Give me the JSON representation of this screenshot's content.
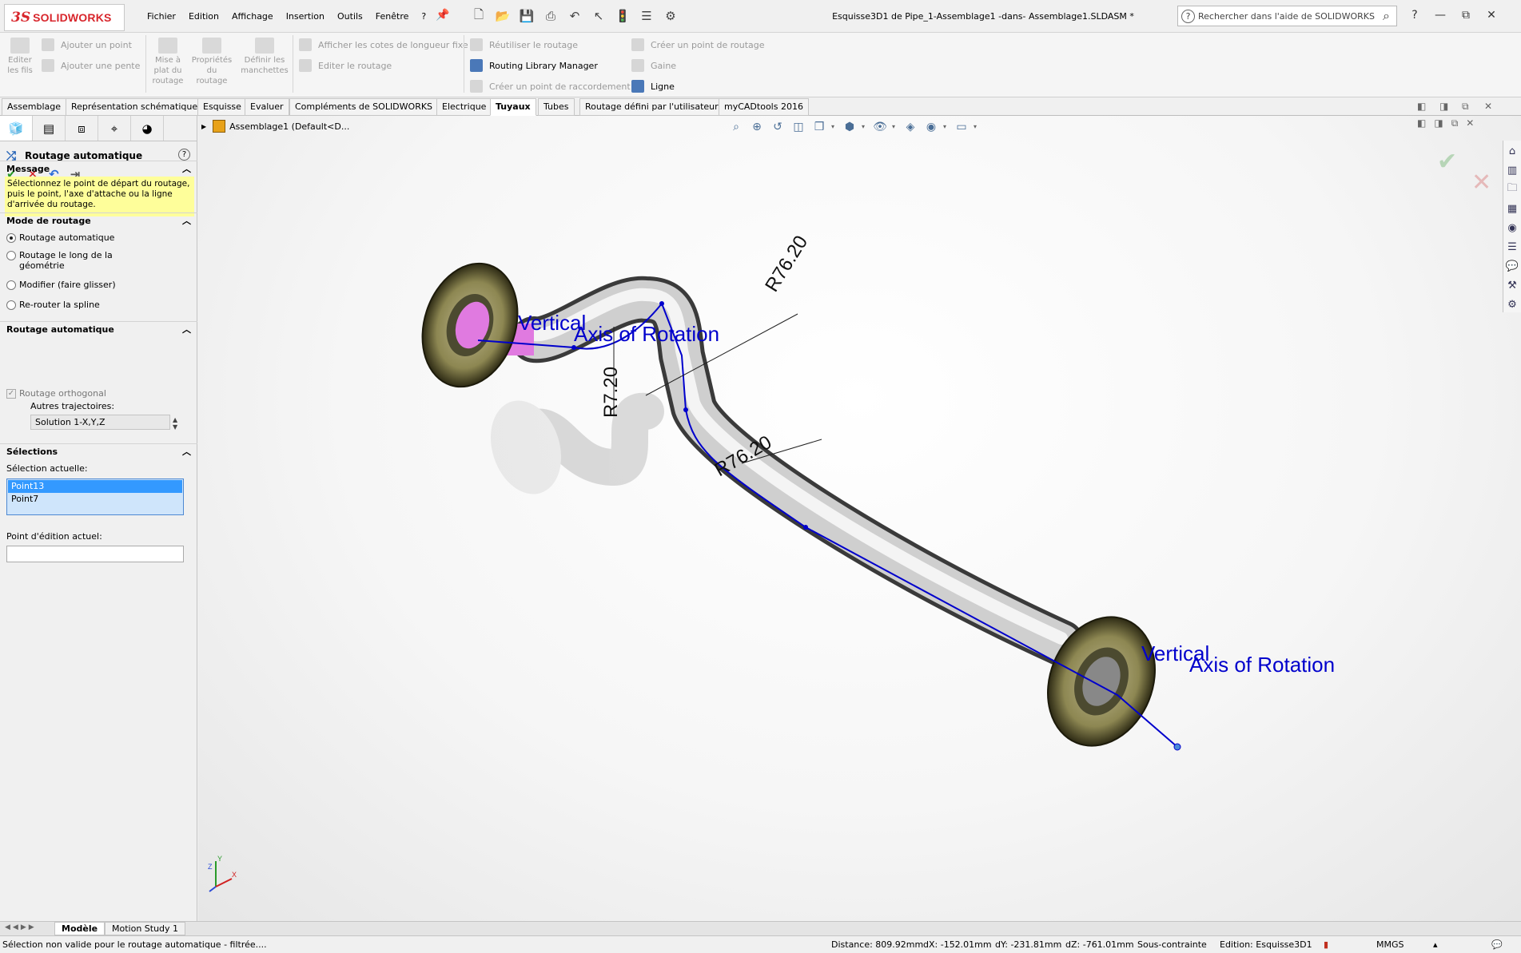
{
  "app": {
    "logo_ds": "3S",
    "logo_name": "SOLIDWORKS"
  },
  "menu": [
    "Fichier",
    "Edition",
    "Affichage",
    "Insertion",
    "Outils",
    "Fenêtre",
    "?"
  ],
  "document_title": "Esquisse3D1 de Pipe_1-Assemblage1 -dans- Assemblage1.SLDASM *",
  "help_search": {
    "placeholder": "Rechercher dans l'aide de SOLIDWORKS"
  },
  "command_manager": {
    "editer_fils": "Editer les fils",
    "ajouter_point": "Ajouter un point",
    "ajouter_pente": "Ajouter une pente",
    "mise_a_plat": "Mise à plat du routage",
    "proprietes": "Propriétés du routage",
    "definir_manchettes": "Définir les manchettes",
    "afficher_cotes": "Afficher les cotes de longueur fixe",
    "editer_routage": "Editer le routage",
    "reutiliser": "Réutiliser le routage",
    "routing_library": "Routing Library Manager",
    "creer_raccordement": "Créer un point de raccordement",
    "creer_routage_pt": "Créer un point de routage",
    "gaine": "Gaine",
    "ligne": "Ligne"
  },
  "tabs": [
    "Assemblage",
    "Représentation schématique",
    "Esquisse",
    "Evaluer",
    "Compléments de SOLIDWORKS",
    "Electrique",
    "Tuyaux",
    "Tubes",
    "Routage défini par l'utilisateur",
    "myCADtools 2016"
  ],
  "active_tab": "Tuyaux",
  "property_manager": {
    "title": "Routage automatique",
    "message_header": "Message",
    "message": "Sélectionnez le point de départ du routage, puis le point, l'axe d'attache ou la ligne d'arrivée du routage.",
    "mode_header": "Mode de routage",
    "modes": [
      "Routage automatique",
      "Routage le long de la géométrie",
      "Modifier (faire glisser)",
      "Re-router la spline"
    ],
    "auto_header": "Routage automatique",
    "orthogonal_label": "Routage orthogonal",
    "autres_label": "Autres trajectoires:",
    "solution_value": "Solution 1-X,Y,Z",
    "selections_header": "Sélections",
    "current_selection_label": "Sélection actuelle:",
    "selection_items": [
      "Point13",
      "Point7"
    ],
    "edit_point_label": "Point d'édition actuel:"
  },
  "feature_tree": {
    "root": "Assemblage1  (Default<D..."
  },
  "viewport": {
    "annotations": {
      "dim1": "R76.20",
      "dim2": "R7.20",
      "dim3": "R76.20",
      "label_a_1": "Vertical",
      "label_a_2": "Axis of Rotation",
      "label_b_1": "Vertical",
      "label_b_2": "Axis of Rotation"
    },
    "triad": {
      "x": "X",
      "y": "Y",
      "z": "Z"
    }
  },
  "bottom_tabs": [
    "Modèle",
    "Motion Study 1"
  ],
  "status": {
    "message": "Sélection non valide pour le routage automatique - filtrée....",
    "distance": "Distance: 809.92mm",
    "dx": "dX: -152.01mm",
    "dy": "dY: -231.81mm",
    "dz": "dZ: -761.01mm",
    "state": "Sous-contrainte",
    "edition": "Edition: Esquisse3D1",
    "units": "MMGS"
  },
  "colors": {
    "accent": "#d8262c",
    "selection": "#3399ff",
    "sketch": "#0000cc",
    "message_bg": "#fefe9a"
  }
}
